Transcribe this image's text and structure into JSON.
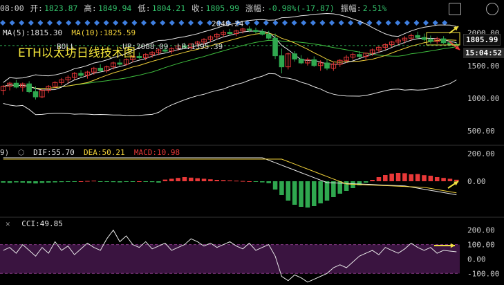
{
  "header": {
    "time": "08:00",
    "open_label": "开:",
    "open": "1823.87",
    "high_label": "高:",
    "high": "1849.94",
    "low_label": "低:",
    "low": "1804.21",
    "close_label": "收:",
    "close": "1805.99",
    "change_label": "涨幅:",
    "change": "-0.98%(-17.87)",
    "amplitude_label": "振幅:",
    "amplitude": "2.51%"
  },
  "ma_line": {
    "ma5_label": "MA(5):",
    "ma5": "1815.30",
    "ma10_label": "MA(10):",
    "ma10": "1825.59",
    "boll_fragment": "BOLL",
    "up_fragment": "UP:2088.09",
    "lb_label": "LB:",
    "lb": "1395.39",
    "top_value": "2040.24"
  },
  "watermark": "ETH以太坊日线技术图",
  "price_tag": "1805.99",
  "countdown_tag": "15:04:52",
  "macd_line": {
    "prefix": "9)",
    "dif_label": "DIF:",
    "dif": "55.70",
    "dea_label": "DEA:",
    "dea": "50.21",
    "macd_label": "MACD:",
    "macd": "10.98"
  },
  "cci_line": {
    "cci_label": "CCI:",
    "cci": "49.85"
  },
  "colors": {
    "up": "#e83838",
    "down": "#2fa84f",
    "ma5": "#e8e8e8",
    "ma10": "#f2d23a",
    "boll_mid": "#3fbf3f",
    "accent": "#f0e040",
    "cci_band": "#3a1440",
    "diamond": "#3f7fe0"
  },
  "chart_data": [
    {
      "type": "candlestick",
      "name_hint": "price",
      "y_ticks": [
        "2000.00",
        "1500.00",
        "1000.00",
        "500.00"
      ],
      "ylim": [
        300,
        2250
      ],
      "candles": [
        [
          1120,
          1200,
          1050,
          1180
        ],
        [
          1180,
          1250,
          1120,
          1230
        ],
        [
          1230,
          1280,
          1150,
          1170
        ],
        [
          1170,
          1240,
          1100,
          1220
        ],
        [
          1220,
          1260,
          1080,
          1100
        ],
        [
          1100,
          1180,
          980,
          1020
        ],
        [
          1020,
          1140,
          1000,
          1120
        ],
        [
          1120,
          1200,
          1080,
          1180
        ],
        [
          1180,
          1260,
          1150,
          1240
        ],
        [
          1240,
          1310,
          1200,
          1280
        ],
        [
          1280,
          1350,
          1230,
          1320
        ],
        [
          1320,
          1400,
          1280,
          1380
        ],
        [
          1380,
          1430,
          1320,
          1350
        ],
        [
          1350,
          1420,
          1300,
          1400
        ],
        [
          1400,
          1480,
          1360,
          1460
        ],
        [
          1460,
          1520,
          1400,
          1420
        ],
        [
          1420,
          1500,
          1390,
          1480
        ],
        [
          1480,
          1560,
          1440,
          1540
        ],
        [
          1540,
          1600,
          1490,
          1520
        ],
        [
          1520,
          1610,
          1500,
          1590
        ],
        [
          1590,
          1660,
          1550,
          1640
        ],
        [
          1640,
          1700,
          1600,
          1620
        ],
        [
          1620,
          1690,
          1580,
          1670
        ],
        [
          1670,
          1720,
          1620,
          1700
        ],
        [
          1700,
          1760,
          1660,
          1740
        ],
        [
          1740,
          1790,
          1690,
          1720
        ],
        [
          1720,
          1780,
          1680,
          1760
        ],
        [
          1760,
          1820,
          1720,
          1800
        ],
        [
          1800,
          1850,
          1760,
          1780
        ],
        [
          1780,
          1840,
          1740,
          1830
        ],
        [
          1830,
          1880,
          1790,
          1860
        ],
        [
          1860,
          1920,
          1820,
          1900
        ],
        [
          1900,
          1960,
          1860,
          1940
        ],
        [
          1940,
          2000,
          1900,
          1980
        ],
        [
          1980,
          2040,
          1940,
          2010
        ],
        [
          2010,
          2060,
          1960,
          1990
        ],
        [
          1990,
          2050,
          1950,
          2030
        ],
        [
          2030,
          2080,
          1990,
          2060
        ],
        [
          2060,
          2100,
          2010,
          2040
        ],
        [
          2040,
          2080,
          1990,
          2020
        ],
        [
          2020,
          2060,
          1960,
          1980
        ],
        [
          1980,
          2030,
          1900,
          1920
        ],
        [
          1920,
          1990,
          1600,
          1650
        ],
        [
          1650,
          1760,
          1380,
          1480
        ],
        [
          1480,
          1700,
          1440,
          1680
        ],
        [
          1680,
          1720,
          1560,
          1600
        ],
        [
          1600,
          1660,
          1520,
          1540
        ],
        [
          1540,
          1620,
          1500,
          1590
        ],
        [
          1590,
          1640,
          1480,
          1500
        ],
        [
          1500,
          1580,
          1420,
          1540
        ],
        [
          1540,
          1600,
          1430,
          1460
        ],
        [
          1460,
          1560,
          1420,
          1520
        ],
        [
          1520,
          1600,
          1480,
          1580
        ],
        [
          1580,
          1660,
          1540,
          1630
        ],
        [
          1630,
          1700,
          1590,
          1670
        ],
        [
          1670,
          1720,
          1610,
          1640
        ],
        [
          1640,
          1700,
          1580,
          1690
        ],
        [
          1690,
          1760,
          1650,
          1740
        ],
        [
          1740,
          1800,
          1700,
          1780
        ],
        [
          1780,
          1840,
          1740,
          1820
        ],
        [
          1820,
          1880,
          1780,
          1860
        ],
        [
          1860,
          1920,
          1820,
          1890
        ],
        [
          1890,
          1950,
          1840,
          1920
        ],
        [
          1920,
          1990,
          1880,
          1960
        ],
        [
          1960,
          2020,
          1900,
          1930
        ],
        [
          1930,
          1990,
          1870,
          1900
        ],
        [
          1900,
          1960,
          1840,
          1870
        ],
        [
          1870,
          1940,
          1830,
          1910
        ],
        [
          1910,
          1950,
          1830,
          1850
        ],
        [
          1850,
          1900,
          1800,
          1824
        ],
        [
          1824,
          1850,
          1804,
          1806
        ]
      ]
    },
    {
      "type": "bar",
      "name_hint": "macd",
      "y_ticks": [
        "200.00",
        "0.00"
      ],
      "ylim": [
        -250,
        250
      ],
      "values": [
        -10,
        -12,
        -8,
        -10,
        -14,
        -16,
        -12,
        -10,
        -8,
        -6,
        -4,
        -2,
        0,
        2,
        4,
        -2,
        -4,
        -6,
        -8,
        -4,
        -2,
        0,
        -2,
        -6,
        -10,
        12,
        18,
        24,
        30,
        26,
        22,
        18,
        14,
        10,
        8,
        6,
        4,
        2,
        0,
        -4,
        -8,
        -14,
        -60,
        -100,
        -140,
        -170,
        -185,
        -190,
        -180,
        -160,
        -140,
        -115,
        -90,
        -70,
        -50,
        -30,
        -10,
        10,
        30,
        45,
        55,
        60,
        58,
        50,
        52,
        44,
        40,
        30,
        24,
        18,
        11
      ]
    },
    {
      "type": "line",
      "name_hint": "cci",
      "y_ticks": [
        "200.00",
        "100.00",
        "0.00",
        "-100.00"
      ],
      "ylim": [
        -180,
        280
      ],
      "values": [
        60,
        80,
        40,
        100,
        60,
        20,
        80,
        40,
        120,
        60,
        90,
        30,
        70,
        110,
        80,
        60,
        140,
        200,
        120,
        160,
        100,
        80,
        120,
        70,
        90,
        110,
        60,
        80,
        100,
        140,
        120,
        90,
        110,
        80,
        100,
        120,
        90,
        70,
        110,
        60,
        80,
        100,
        20,
        -120,
        -150,
        -110,
        -130,
        -160,
        -140,
        -120,
        -100,
        -60,
        -40,
        -60,
        -20,
        20,
        40,
        60,
        30,
        80,
        60,
        40,
        70,
        110,
        80,
        60,
        80,
        40,
        60,
        55,
        50
      ]
    }
  ]
}
